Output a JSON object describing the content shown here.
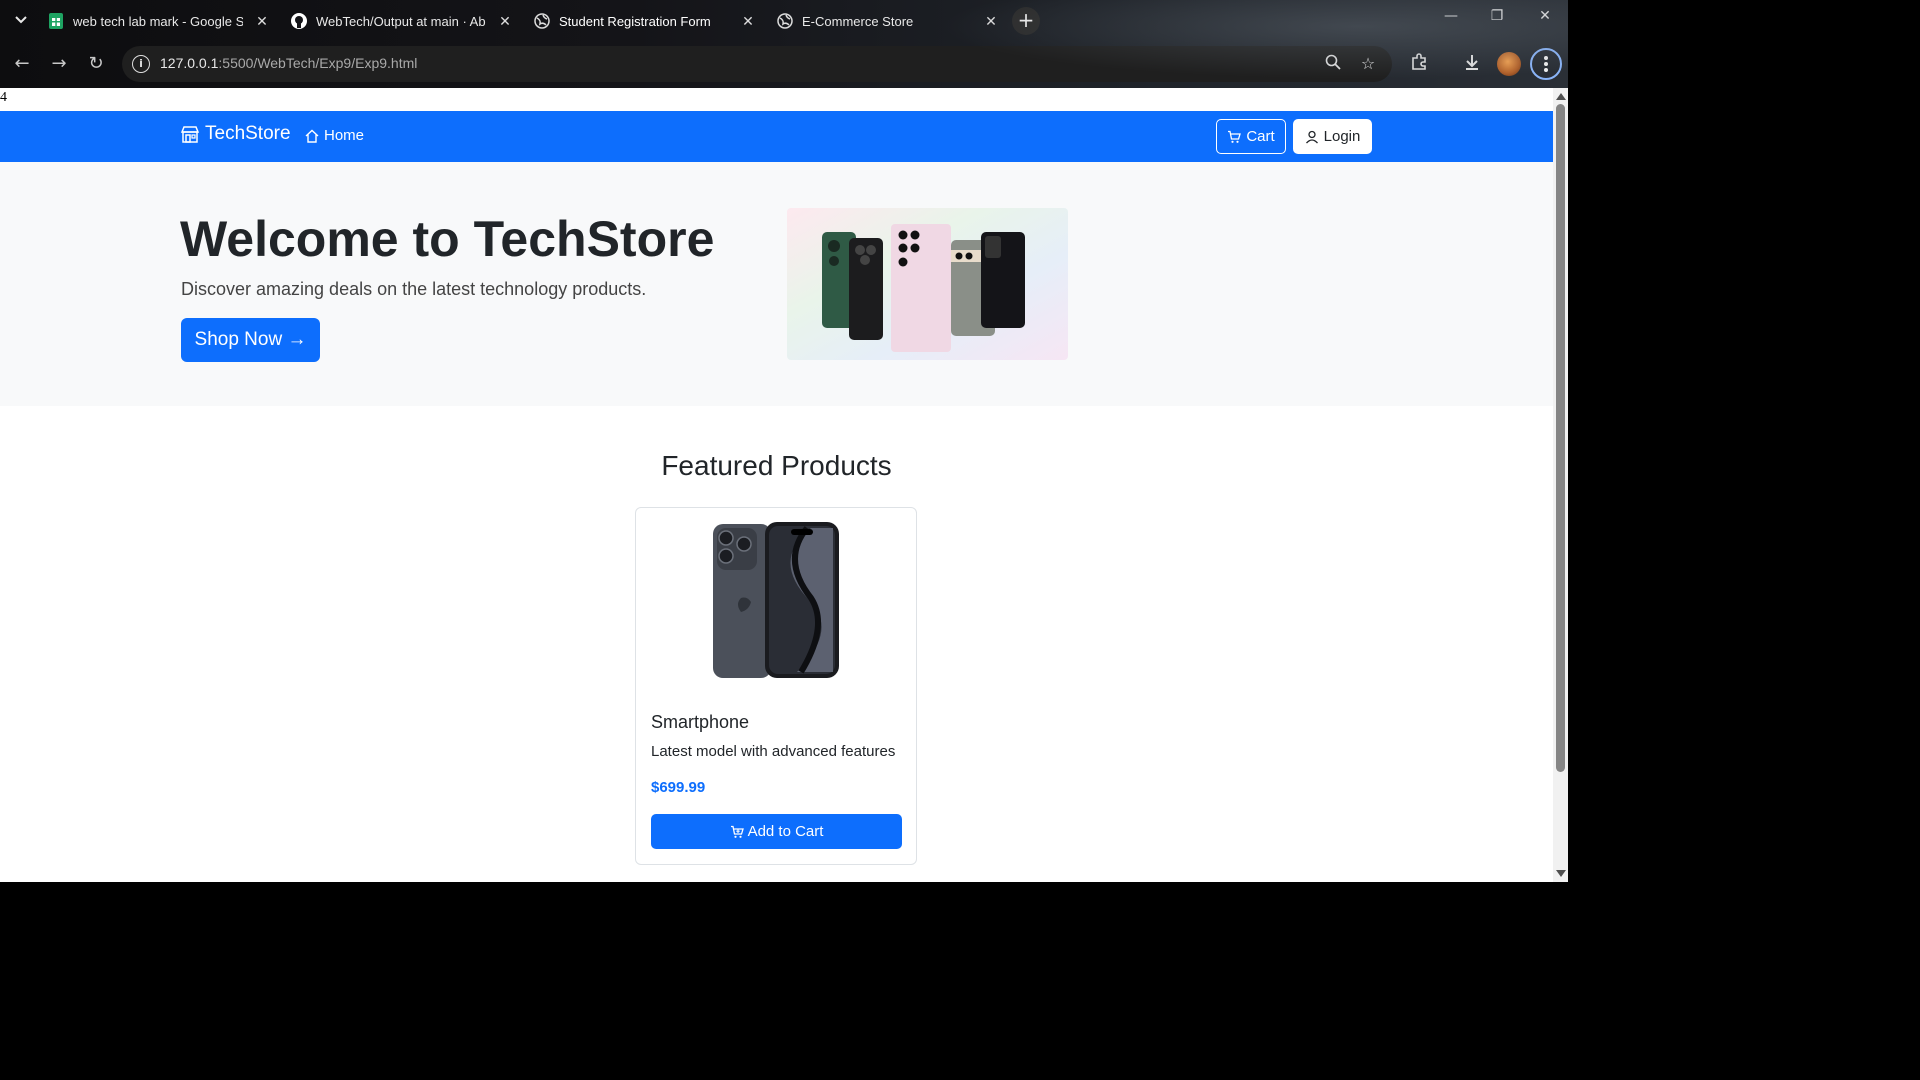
{
  "browser": {
    "tabs": [
      {
        "title": "web tech lab mark - Google Sheets",
        "favicon": "sheets-icon",
        "active": false
      },
      {
        "title": "WebTech/Output at main · Abhi",
        "favicon": "github-icon",
        "active": false
      },
      {
        "title": "Student Registration Form",
        "favicon": "globe-icon",
        "active": true
      },
      {
        "title": "E-Commerce Store",
        "favicon": "globe-icon",
        "active": false
      }
    ],
    "url_host": "127.0.0.1",
    "url_path": ":5500/WebTech/Exp9/Exp9.html"
  },
  "page": {
    "stray_text": "4",
    "nav": {
      "brand": "TechStore",
      "home": "Home",
      "cart": "Cart",
      "login": "Login"
    },
    "hero": {
      "title": "Welcome to TechStore",
      "subtitle": "Discover amazing deals on the latest technology products.",
      "cta": "Shop Now →"
    },
    "featured": {
      "title": "Featured Products",
      "products": [
        {
          "name": "Smartphone",
          "description": "Latest model with advanced features",
          "price": "$699.99",
          "button": "Add to Cart"
        }
      ]
    }
  },
  "colors": {
    "primary": "#0d6efd",
    "hero_bg": "#f8f9fa",
    "text": "#212529"
  }
}
